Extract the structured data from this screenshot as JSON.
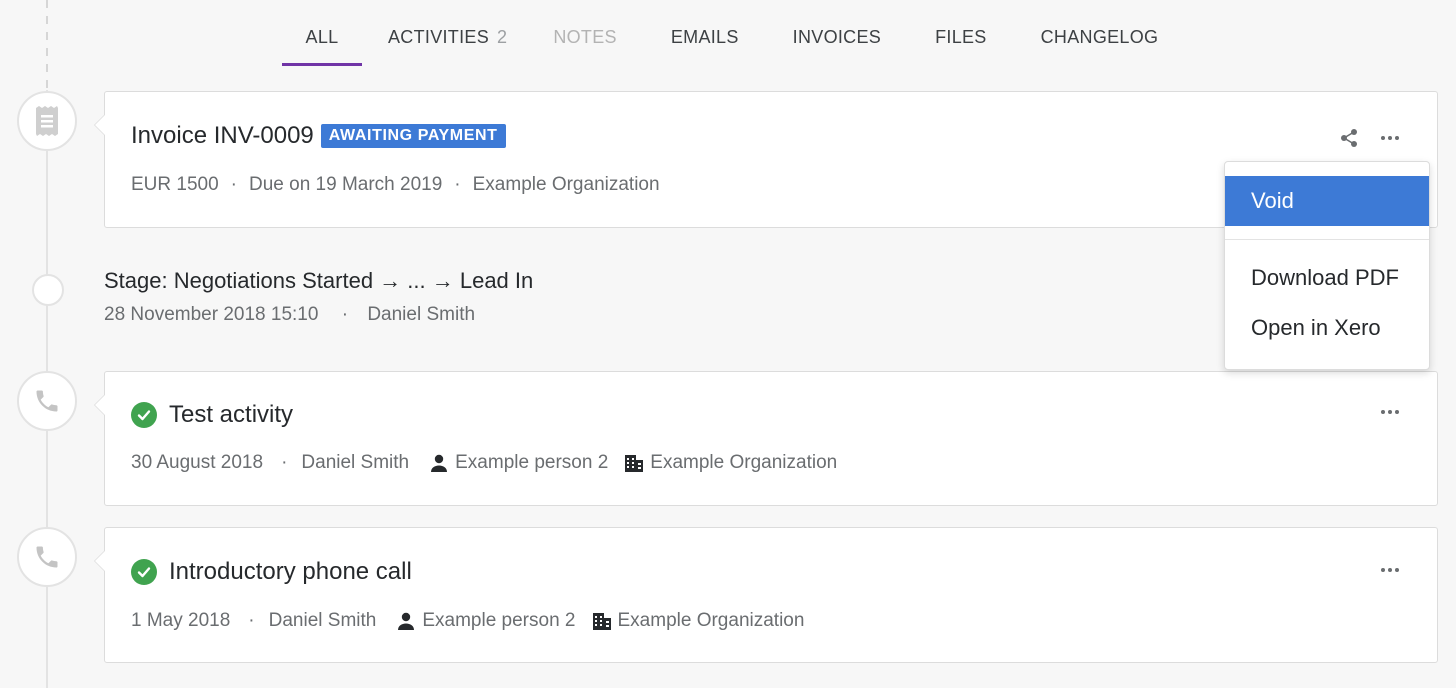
{
  "tabs": [
    {
      "label": "ALL",
      "active": true
    },
    {
      "label": "ACTIVITIES",
      "count": "2"
    },
    {
      "label": "NOTES",
      "disabled": true
    },
    {
      "label": "EMAILS"
    },
    {
      "label": "INVOICES"
    },
    {
      "label": "FILES"
    },
    {
      "label": "CHANGELOG"
    }
  ],
  "invoice": {
    "icon": "receipt-icon",
    "title": "Invoice INV-0009",
    "badge": "AWAITING PAYMENT",
    "amount": "EUR 1500",
    "due": "Due on 19 March 2019",
    "organization": "Example Organization"
  },
  "stage": {
    "title": "Stage: Negotiations Started → ... → Lead In",
    "datetime": "28 November 2018 15:10",
    "user": "Daniel Smith"
  },
  "activities": [
    {
      "icon": "phone-icon",
      "title": "Test activity",
      "date": "30 August 2018",
      "user": "Daniel Smith",
      "person": "Example person 2",
      "organization": "Example Organization"
    },
    {
      "icon": "phone-icon",
      "title": "Introductory phone call",
      "date": "1 May 2018",
      "user": "Daniel Smith",
      "person": "Example person 2",
      "organization": "Example Organization"
    }
  ],
  "dropdown": {
    "items": [
      "Void",
      "Download PDF",
      "Open in Xero"
    ],
    "selected": "Void"
  },
  "colors": {
    "accent_tab": "#7034a6",
    "badge_blue": "#3d7ad6",
    "success_green": "#40a34f"
  }
}
